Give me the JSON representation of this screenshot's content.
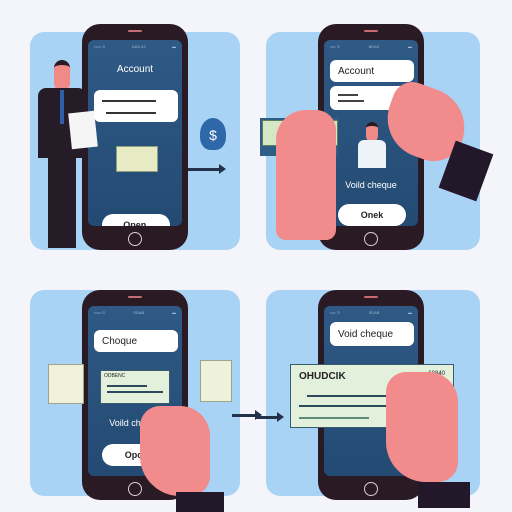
{
  "panels": [
    {
      "title": "Account",
      "button": "Open.",
      "status_left": "••••• ⊙",
      "status_mid": "DAS.43"
    },
    {
      "field1": "Account",
      "label": "Voild cheque",
      "button": "Onek",
      "status_mid": "BDAS"
    },
    {
      "field1": "Choque",
      "cheque_name": "ODBENC",
      "label": "Voild choque",
      "button": "Opck",
      "status_mid": "SDAB"
    },
    {
      "field1": "Void cheque",
      "cheque_name": "OHUDCIK",
      "cheque_amount": "68840",
      "status_mid": "SDAB"
    }
  ],
  "icons": {
    "money_bag": "$"
  }
}
